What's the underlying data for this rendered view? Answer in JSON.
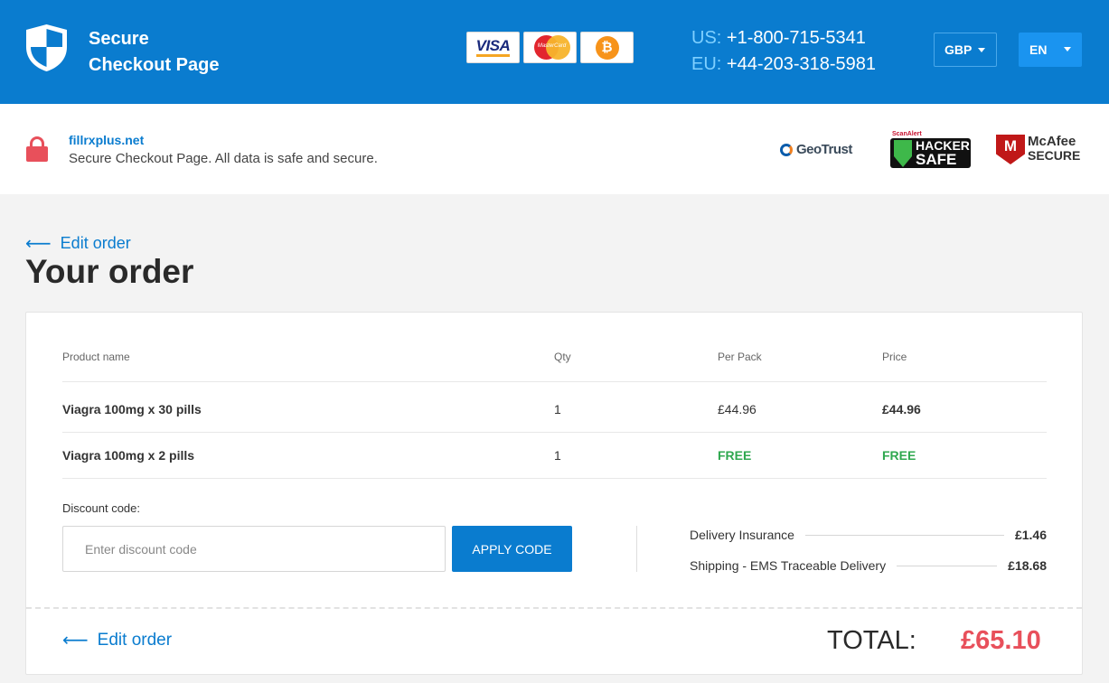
{
  "header": {
    "brand_line1": "Secure",
    "brand_line2": "Checkout Page",
    "payments": {
      "visa": "VISA",
      "mastercard": "MasterCard",
      "bitcoin": "₿"
    },
    "phones": [
      {
        "label": "US:",
        "number": "+1-800-715-5341"
      },
      {
        "label": "EU:",
        "number": "+44-203-318-5981"
      }
    ],
    "currency": "GBP",
    "language": "EN",
    "colors": {
      "bar": "#0a7ccf",
      "accent": "#e8505b",
      "free": "#2fa84f"
    }
  },
  "secure_bar": {
    "site": "fillrxplus.net",
    "note": "Secure Checkout Page. All data is safe and secure.",
    "badges": {
      "geotrust": "GeoTrust",
      "scanalert": "ScanAlert",
      "hacker_line1": "HACKER",
      "hacker_line2": "SAFE",
      "mcafee_line1": "McAfee",
      "mcafee_line2": "SECURE",
      "mcafee_letter": "M"
    }
  },
  "main": {
    "edit_order": "Edit order",
    "title": "Your order",
    "columns": [
      "Product name",
      "Qty",
      "Per Pack",
      "Price"
    ],
    "items": [
      {
        "name": "Viagra 100mg x 30 pills",
        "qty": "1",
        "per_pack": "£44.96",
        "price": "£44.96"
      },
      {
        "name": "Viagra 100mg x 2 pills",
        "qty": "1",
        "per_pack": "FREE",
        "price": "FREE"
      }
    ],
    "discount": {
      "label": "Discount code:",
      "placeholder": "Enter discount code",
      "value": "",
      "button": "APPLY CODE"
    },
    "fees": [
      {
        "label": "Delivery Insurance",
        "amount": "£1.46"
      },
      {
        "label": "Shipping - EMS Traceable Delivery",
        "amount": "£18.68"
      }
    ],
    "total_label": "TOTAL:",
    "total_value": "£65.10"
  }
}
